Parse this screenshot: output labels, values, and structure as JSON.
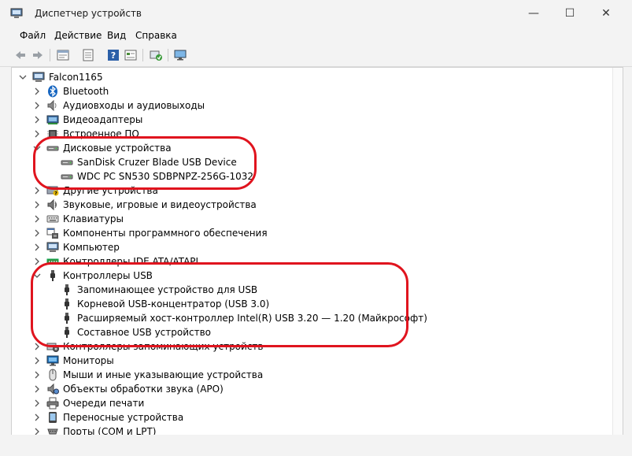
{
  "window": {
    "title": "Диспетчер устройств",
    "icon": "device-manager-icon",
    "controls": {
      "minimize": "—",
      "maximize": "☐",
      "close": "✕"
    }
  },
  "menu": {
    "items": [
      "Файл",
      "Действие",
      "Вид",
      "Справка"
    ]
  },
  "toolbar": {
    "icons": [
      "back-arrow-icon",
      "forward-arrow-icon",
      "properties-icon",
      "details-icon",
      "help-icon",
      "view-icon",
      "update-driver-icon",
      "monitor-scan-icon"
    ]
  },
  "tree": {
    "root": "Falcon1165",
    "categories": [
      {
        "label": "Bluetooth",
        "icon": "bluetooth-icon",
        "expanded": false
      },
      {
        "label": "Аудиовходы и аудиовыходы",
        "icon": "speaker-icon",
        "expanded": false
      },
      {
        "label": "Видеоадаптеры",
        "icon": "display-adapter-icon",
        "expanded": false
      },
      {
        "label": "Встроенное ПО",
        "icon": "firmware-icon",
        "expanded": false
      },
      {
        "label": "Дисковые устройства",
        "icon": "disk-drive-icon",
        "expanded": true,
        "children": [
          "SanDisk Cruzer Blade USB Device",
          "WDC PC SN530 SDBPNPZ-256G-1032"
        ]
      },
      {
        "label": "Другие устройства",
        "icon": "unknown-device-icon",
        "expanded": false
      },
      {
        "label": "Звуковые, игровые и видеоустройства",
        "icon": "sound-device-icon",
        "expanded": false
      },
      {
        "label": "Клавиатуры",
        "icon": "keyboard-icon",
        "expanded": false
      },
      {
        "label": "Компоненты программного обеспечения",
        "icon": "software-component-icon",
        "expanded": false
      },
      {
        "label": "Компьютер",
        "icon": "computer-icon",
        "expanded": false
      },
      {
        "label": "Контроллеры IDE ATA/ATAPI",
        "icon": "ide-controller-icon",
        "expanded": false
      },
      {
        "label": "Контроллеры USB",
        "icon": "usb-controller-icon",
        "expanded": true,
        "children": [
          "Запоминающее устройство для USB",
          "Корневой USB-концентратор (USB 3.0)",
          "Расширяемый хост-контроллер Intel(R) USB 3.20 — 1.20 (Майкрософт)",
          "Составное USB устройство"
        ]
      },
      {
        "label": "Контроллеры запоминающих устройств",
        "icon": "storage-controller-icon",
        "expanded": false
      },
      {
        "label": "Мониторы",
        "icon": "monitor-icon",
        "expanded": false
      },
      {
        "label": "Мыши и иные указывающие устройства",
        "icon": "mouse-icon",
        "expanded": false
      },
      {
        "label": "Объекты обработки звука (APO)",
        "icon": "audio-processing-icon",
        "expanded": false
      },
      {
        "label": "Очереди печати",
        "icon": "printer-icon",
        "expanded": false
      },
      {
        "label": "Переносные устройства",
        "icon": "portable-device-icon",
        "expanded": false
      },
      {
        "label": "Порты (COM и LPT)",
        "icon": "port-icon",
        "expanded": false
      }
    ]
  },
  "annotations": {
    "color": "#e0141e"
  }
}
